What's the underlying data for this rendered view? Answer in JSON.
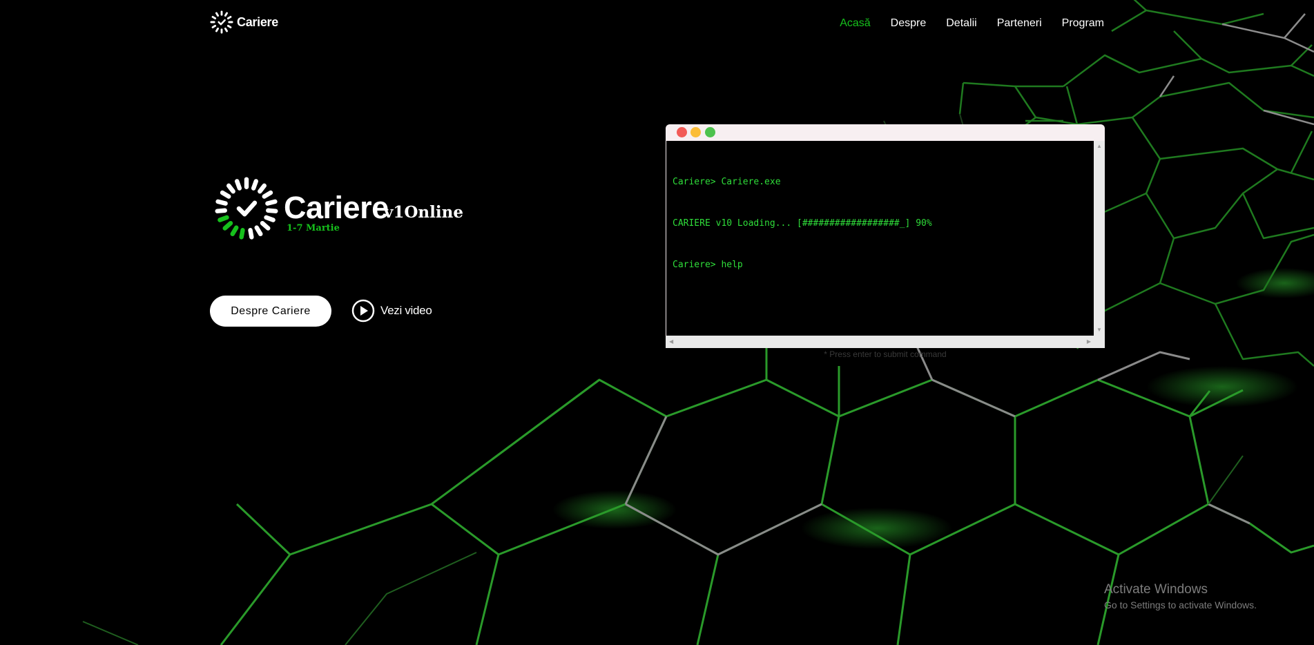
{
  "nav": {
    "logo_text": "Cariere",
    "links": [
      {
        "label": "Acasă",
        "active": true
      },
      {
        "label": "Despre",
        "active": false
      },
      {
        "label": "Detalii",
        "active": false
      },
      {
        "label": "Parteneri",
        "active": false
      },
      {
        "label": "Program",
        "active": false
      }
    ]
  },
  "hero": {
    "title": "Cariere",
    "version": "v1Online",
    "dates": "1-7 Martie",
    "primary_button": "Despre Cariere",
    "video_link": "Vezi video"
  },
  "terminal": {
    "lines": [
      "Cariere> Cariere.exe",
      "CARIERE v10 Loading... [##################_] 90%",
      "Cariere> help"
    ],
    "hint": "* Press enter to submit command"
  },
  "watermark": {
    "title": "Activate Windows",
    "subtitle": "Go to Settings to activate Windows."
  },
  "colors": {
    "accent": "#16c01c",
    "terminal_text": "#2fdd3a",
    "background": "#000000"
  },
  "icons": {
    "logo": "check-spinner-icon",
    "video": "play-circle-icon"
  }
}
